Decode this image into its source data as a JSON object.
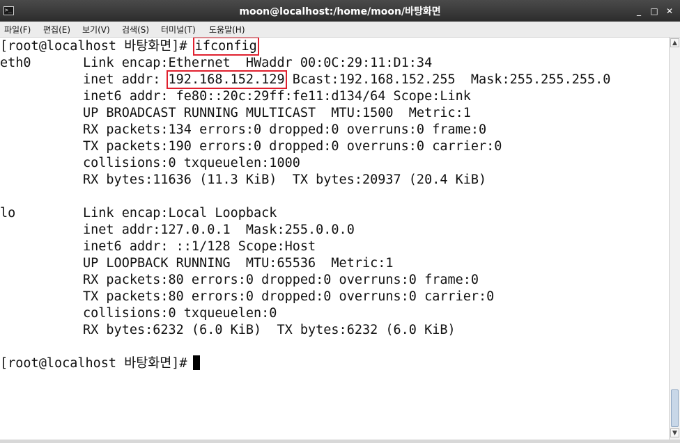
{
  "window": {
    "title": "moon@localhost:/home/moon/바탕화면",
    "app_icon": "terminal-icon",
    "controls": {
      "minimize": "_",
      "maximize": "□",
      "close": "✕"
    }
  },
  "menubar": {
    "items": [
      "파일(F)",
      "편집(E)",
      "보기(V)",
      "검색(S)",
      "터미널(T)",
      "도움말(H)"
    ]
  },
  "terminal": {
    "prompt": "[root@localhost 바탕화면]#",
    "command": "ifconfig",
    "eth0": {
      "iface": "eth0",
      "l1": "Link encap:Ethernet  HWaddr 00:0C:29:11:D1:34",
      "l2_label": "inet addr:",
      "l2_ip": "192.168.152.129",
      "l2_rest": " Bcast:192.168.152.255  Mask:255.255.255.0",
      "l3": "inet6 addr: fe80::20c:29ff:fe11:d134/64 Scope:Link",
      "l4": "UP BROADCAST RUNNING MULTICAST  MTU:1500  Metric:1",
      "l5": "RX packets:134 errors:0 dropped:0 overruns:0 frame:0",
      "l6": "TX packets:190 errors:0 dropped:0 overruns:0 carrier:0",
      "l7": "collisions:0 txqueuelen:1000",
      "l8": "RX bytes:11636 (11.3 KiB)  TX bytes:20937 (20.4 KiB)"
    },
    "lo": {
      "iface": "lo",
      "l1": "Link encap:Local Loopback",
      "l2": "inet addr:127.0.0.1  Mask:255.0.0.0",
      "l3": "inet6 addr: ::1/128 Scope:Host",
      "l4": "UP LOOPBACK RUNNING  MTU:65536  Metric:1",
      "l5": "RX packets:80 errors:0 dropped:0 overruns:0 frame:0",
      "l6": "TX packets:80 errors:0 dropped:0 overruns:0 carrier:0",
      "l7": "collisions:0 txqueuelen:0",
      "l8": "RX bytes:6232 (6.0 KiB)  TX bytes:6232 (6.0 KiB)"
    },
    "prompt2": "[root@localhost 바탕화면]#",
    "highlight_color": "#e0202e"
  },
  "scrollbar": {
    "up": "▲",
    "down": "▼"
  }
}
